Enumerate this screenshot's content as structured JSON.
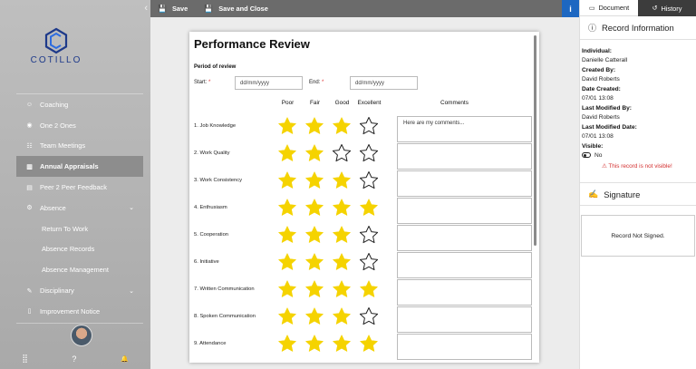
{
  "sidebar": {
    "collapse_icon": "‹",
    "logo_text": "COTILLO",
    "items": [
      {
        "label": "Coaching",
        "icon": "☺"
      },
      {
        "label": "One 2 Ones",
        "icon": "◉"
      },
      {
        "label": "Team Meetings",
        "icon": "☷"
      },
      {
        "label": "Annual Appraisals",
        "icon": "▥"
      },
      {
        "label": "Peer 2 Peer Feedback",
        "icon": "▤"
      },
      {
        "label": "Absence",
        "icon": "⚙",
        "chevron": "⌄"
      },
      {
        "label": "Return To Work"
      },
      {
        "label": "Absence Records"
      },
      {
        "label": "Absence Management"
      },
      {
        "label": "Disciplinary",
        "icon": "✎",
        "chevron": "⌄"
      },
      {
        "label": "Improvement Notice",
        "icon": "▯"
      }
    ],
    "bottom": {
      "grid_icon": "⣿",
      "help_icon": "?",
      "bell_icon": "🔔"
    }
  },
  "toolbar": {
    "save_label": "Save",
    "save_close_label": "Save and Close",
    "info_label": "i"
  },
  "document": {
    "title": "Performance Review",
    "period_label": "Period of review",
    "start_label": "Start:",
    "end_label": "End:",
    "required_mark": "*",
    "date_placeholder": "dd/mm/yyyy",
    "columns": [
      "Poor",
      "Fair",
      "Good",
      "Excellent"
    ],
    "comments_header": "Comments",
    "rows": [
      {
        "label": "1. Job Knowledge",
        "rating": 3,
        "comment": "Here are my comments..."
      },
      {
        "label": "2. Work Quality",
        "rating": 2,
        "comment": ""
      },
      {
        "label": "3. Work Consistency",
        "rating": 3,
        "comment": ""
      },
      {
        "label": "4. Enthusiasm",
        "rating": 4,
        "comment": ""
      },
      {
        "label": "5. Cooperation",
        "rating": 3,
        "comment": ""
      },
      {
        "label": "6. Initiative",
        "rating": 3,
        "comment": ""
      },
      {
        "label": "7. Written Communication",
        "rating": 4,
        "comment": ""
      },
      {
        "label": "8. Spoken Communication",
        "rating": 3,
        "comment": ""
      },
      {
        "label": "9. Attendance",
        "rating": 4,
        "comment": ""
      }
    ],
    "star_color": "#f5d300"
  },
  "panel": {
    "tab_document": "Document",
    "tab_history": "History",
    "record_info_title": "Record Information",
    "individual_label": "Individual:",
    "individual_value": "Danielle Catterall",
    "created_by_label": "Created By:",
    "created_by_value": "David Roberts",
    "date_created_label": "Date Created:",
    "date_created_value": "07/01 13:08",
    "last_modified_by_label": "Last Modified By:",
    "last_modified_by_value": "David Roberts",
    "last_modified_date_label": "Last Modified Date:",
    "last_modified_date_value": "07/01 13:08",
    "visible_label": "Visible:",
    "visible_value": "No",
    "warning_icon": "⚠",
    "warning_text": "This record is not visible!",
    "signature_title": "Signature",
    "signature_status": "Record Not Signed."
  },
  "colors": {
    "accent": "#1d67c1",
    "toolbar": "#6b6b6b",
    "active_nav": "#8d8d8d",
    "warning": "#d32f2f"
  }
}
